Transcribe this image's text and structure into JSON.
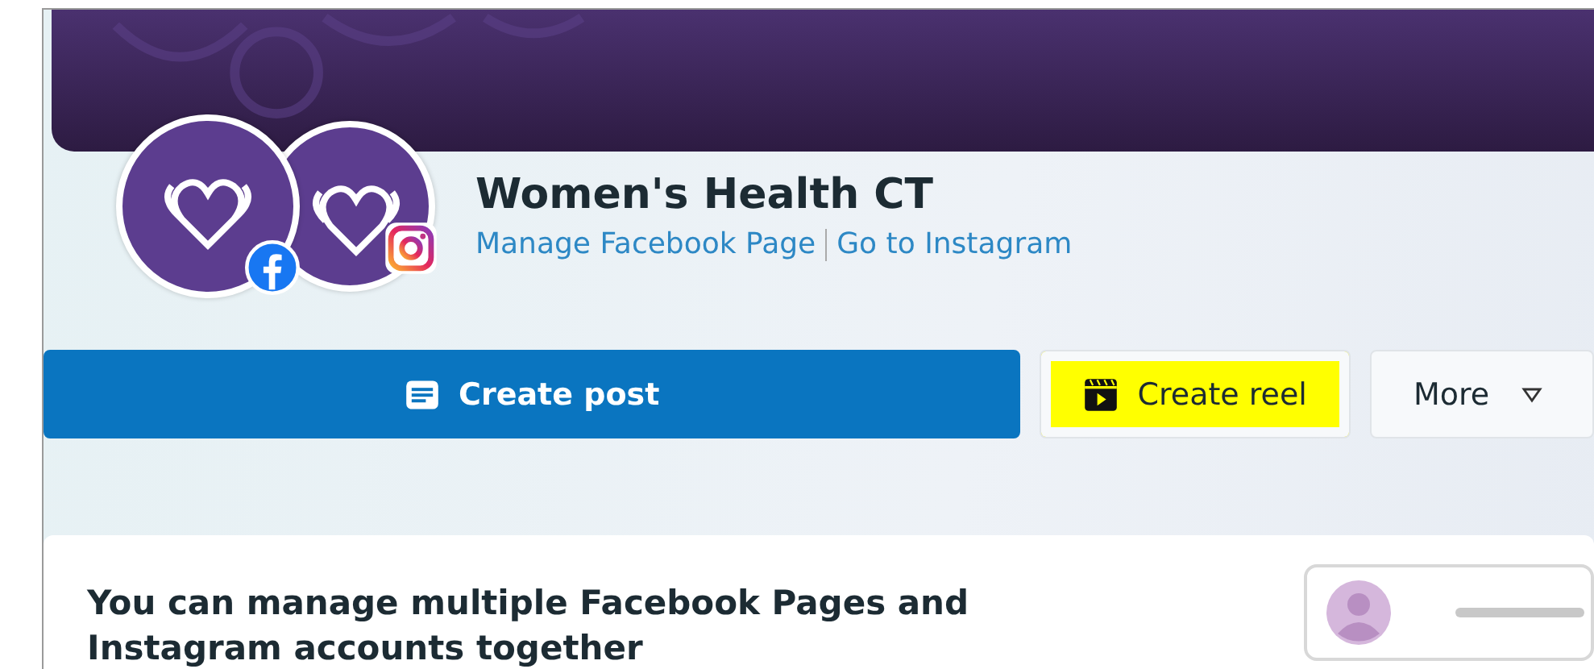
{
  "page": {
    "name": "Women's Health CT",
    "links": [
      {
        "label": "Manage Facebook Page"
      },
      {
        "label": "Go to Instagram"
      }
    ]
  },
  "actions": [
    {
      "kind": "primary",
      "label": "Create post",
      "highlighted": false
    },
    {
      "kind": "reel",
      "label": "Create reel",
      "highlighted": true
    },
    {
      "kind": "menu",
      "label": "More",
      "highlighted": false
    }
  ],
  "card": {
    "heading": "You can manage multiple Facebook Pages and Instagram accounts together"
  }
}
